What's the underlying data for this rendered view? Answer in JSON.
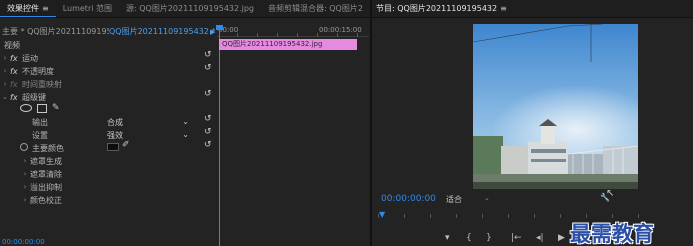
{
  "tabs": [
    {
      "label": "效果控件",
      "active": true
    },
    {
      "label": "Lumetri 范围",
      "active": false
    },
    {
      "label": "源: QQ图片20211109195432.jpg",
      "active": false
    },
    {
      "label": "音频剪辑混合器: QQ图片2",
      "active": false
    }
  ],
  "effect_controls": {
    "master_label": "主要 * QQ图片20211109195...",
    "sequence_label": "QQ图片20211109195432 *",
    "ruler_start": "00:00",
    "ruler_end": "00:00:15:00",
    "clip_label": "QQ图片20211109195432.jpg",
    "section_video": "视频",
    "effects": [
      {
        "name": "运动",
        "has_fx": true
      },
      {
        "name": "不透明度",
        "has_fx": true
      },
      {
        "name": "时间重映射",
        "has_fx": false
      },
      {
        "name": "超级键",
        "has_fx": true
      }
    ],
    "output_label": "输出",
    "output_value": "合成",
    "setting_label": "设置",
    "setting_value": "强效",
    "key_color_label": "主要颜色",
    "subsections": [
      "遮罩生成",
      "遮罩清除",
      "溢出抑制",
      "颜色校正"
    ],
    "bottom_timecode": "00:00:00:00"
  },
  "program": {
    "title": "节目: QQ图片20211109195432",
    "timecode": "00:00:00:00",
    "fit_label": "适合"
  },
  "watermark": "最需教育",
  "colors": {
    "accent": "#2d8ceb",
    "clip_pink": "#e48ae0"
  }
}
